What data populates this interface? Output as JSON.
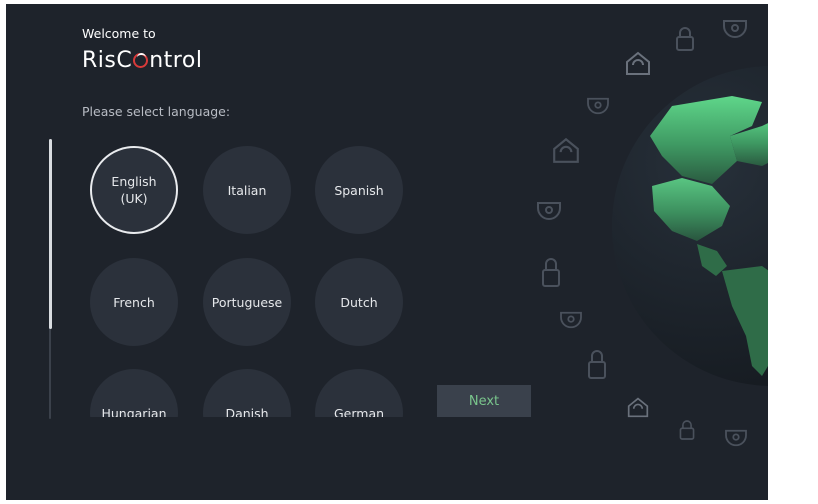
{
  "header": {
    "welcome": "Welcome to",
    "brand_prefix": "RisC",
    "brand_suffix": "ntrol"
  },
  "prompt": "Please select language:",
  "languages": [
    {
      "label": "English\n(UK)",
      "selected": true
    },
    {
      "label": "Italian",
      "selected": false
    },
    {
      "label": "Spanish",
      "selected": false
    },
    {
      "label": "French",
      "selected": false
    },
    {
      "label": "Portuguese",
      "selected": false
    },
    {
      "label": "Dutch",
      "selected": false
    },
    {
      "label": "Hungarian",
      "selected": false
    },
    {
      "label": "Danish",
      "selected": false
    },
    {
      "label": "German",
      "selected": false
    }
  ],
  "next_button": "Next",
  "colors": {
    "background": "#1e232b",
    "circle": "#2b313b",
    "accent_green": "#79c58c",
    "logo_red": "#d83a3a"
  },
  "decor_icons": [
    "house-shield-icon",
    "padlock-icon",
    "security-camera-icon",
    "globe-icon"
  ]
}
